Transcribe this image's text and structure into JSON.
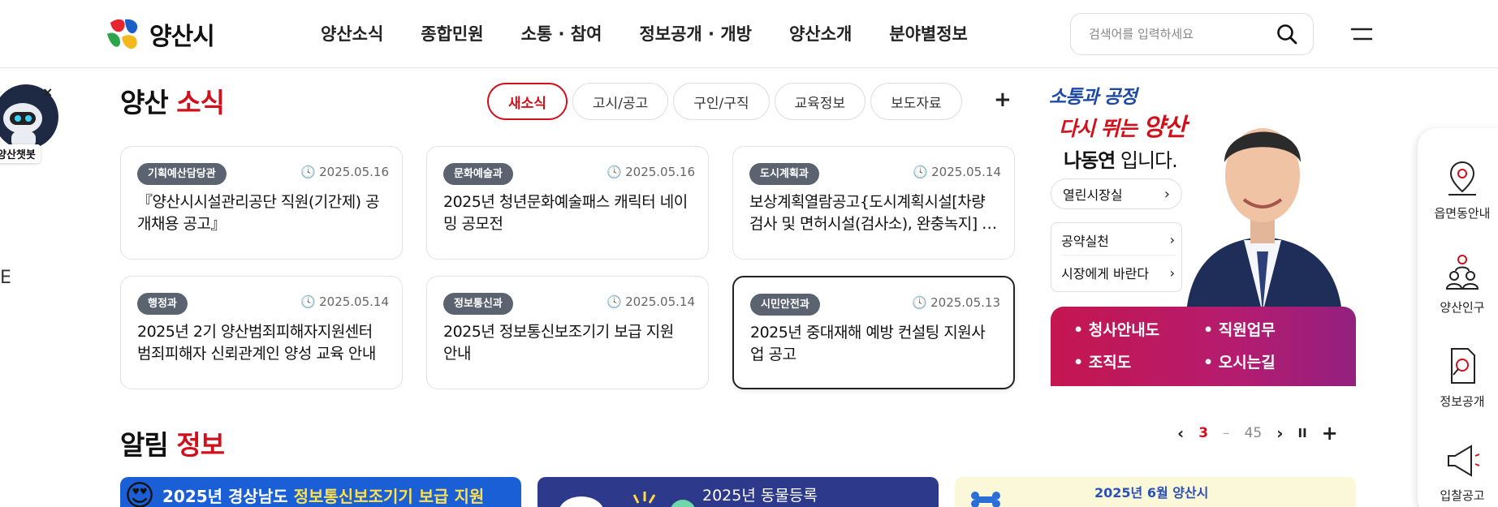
{
  "header": {
    "logo_text": "양산시",
    "nav": [
      "양산소식",
      "종합민원",
      "소통 · 참여",
      "정보공개 · 개방",
      "양산소개",
      "분야별정보"
    ],
    "search_placeholder": "검색어를 입력하세요"
  },
  "chatbot": {
    "label": "양산챗봇",
    "close": "×"
  },
  "left_edge_text": "E",
  "news": {
    "title_black": "양산",
    "title_red": "소식",
    "tabs": [
      "새소식",
      "고시/공고",
      "구인/구직",
      "교육정보",
      "보도자료"
    ],
    "active_tab": 0,
    "more": "+",
    "cards": [
      {
        "dept": "기획예산담당관",
        "date": "2025.05.16",
        "title": "『양산시시설관리공단 직원(기간제) 공개채용 공고』"
      },
      {
        "dept": "문화예술과",
        "date": "2025.05.16",
        "title": "2025년 청년문화예술패스 캐릭터 네이밍 공모전"
      },
      {
        "dept": "도시계획과",
        "date": "2025.05.14",
        "title": "보상계획열람공고{도시계획시설[차량검사 및 면허시설(검사소), 완충녹지] 조성사업}"
      },
      {
        "dept": "행정과",
        "date": "2025.05.14",
        "title": "2025년 2기 양산범죄피해자지원센터 범죄피해자 신뢰관계인 양성 교육 안내"
      },
      {
        "dept": "정보통신과",
        "date": "2025.05.14",
        "title": "2025년 정보통신보조기기 보급 지원 안내"
      },
      {
        "dept": "시민안전과",
        "date": "2025.05.13",
        "title": "2025년 중대재해 예방 컨설팅 지원사업 공고"
      }
    ]
  },
  "mayor": {
    "slogan_line1": "소통과 공정",
    "slogan_line2_prefix": "다시 뛰는",
    "slogan_line2_city": "양산",
    "name": "나동연",
    "name_suffix": " 입니다.",
    "open_office": "열린시장실",
    "pledge": "공약실천",
    "ask_mayor": "시장에게 바란다",
    "quick_links": [
      "청사안내도",
      "직원업무",
      "조직도",
      "오시는길"
    ]
  },
  "quick_menu": [
    "읍면동안내",
    "양산인구",
    "정보공개",
    "입찰공고"
  ],
  "notice": {
    "title_black": "알림",
    "title_red": "정보",
    "current": "3",
    "separator": "–",
    "total": "45",
    "prev": "‹",
    "next": "›",
    "pause": "II",
    "more": "+",
    "banners": [
      {
        "emoji": "😍",
        "text_white": "2025년 경상남도",
        "text_yellow": "정보통신보조기기 보급 지원"
      },
      {
        "text": "2025년 동물등록"
      },
      {
        "text": "2025년 6월 양산시"
      }
    ]
  },
  "colors": {
    "accent_red": "#d0111b",
    "dept_badge": "#5b6370",
    "panel_magenta": "#b51c6f",
    "slogan_blue": "#1d4aa8"
  }
}
